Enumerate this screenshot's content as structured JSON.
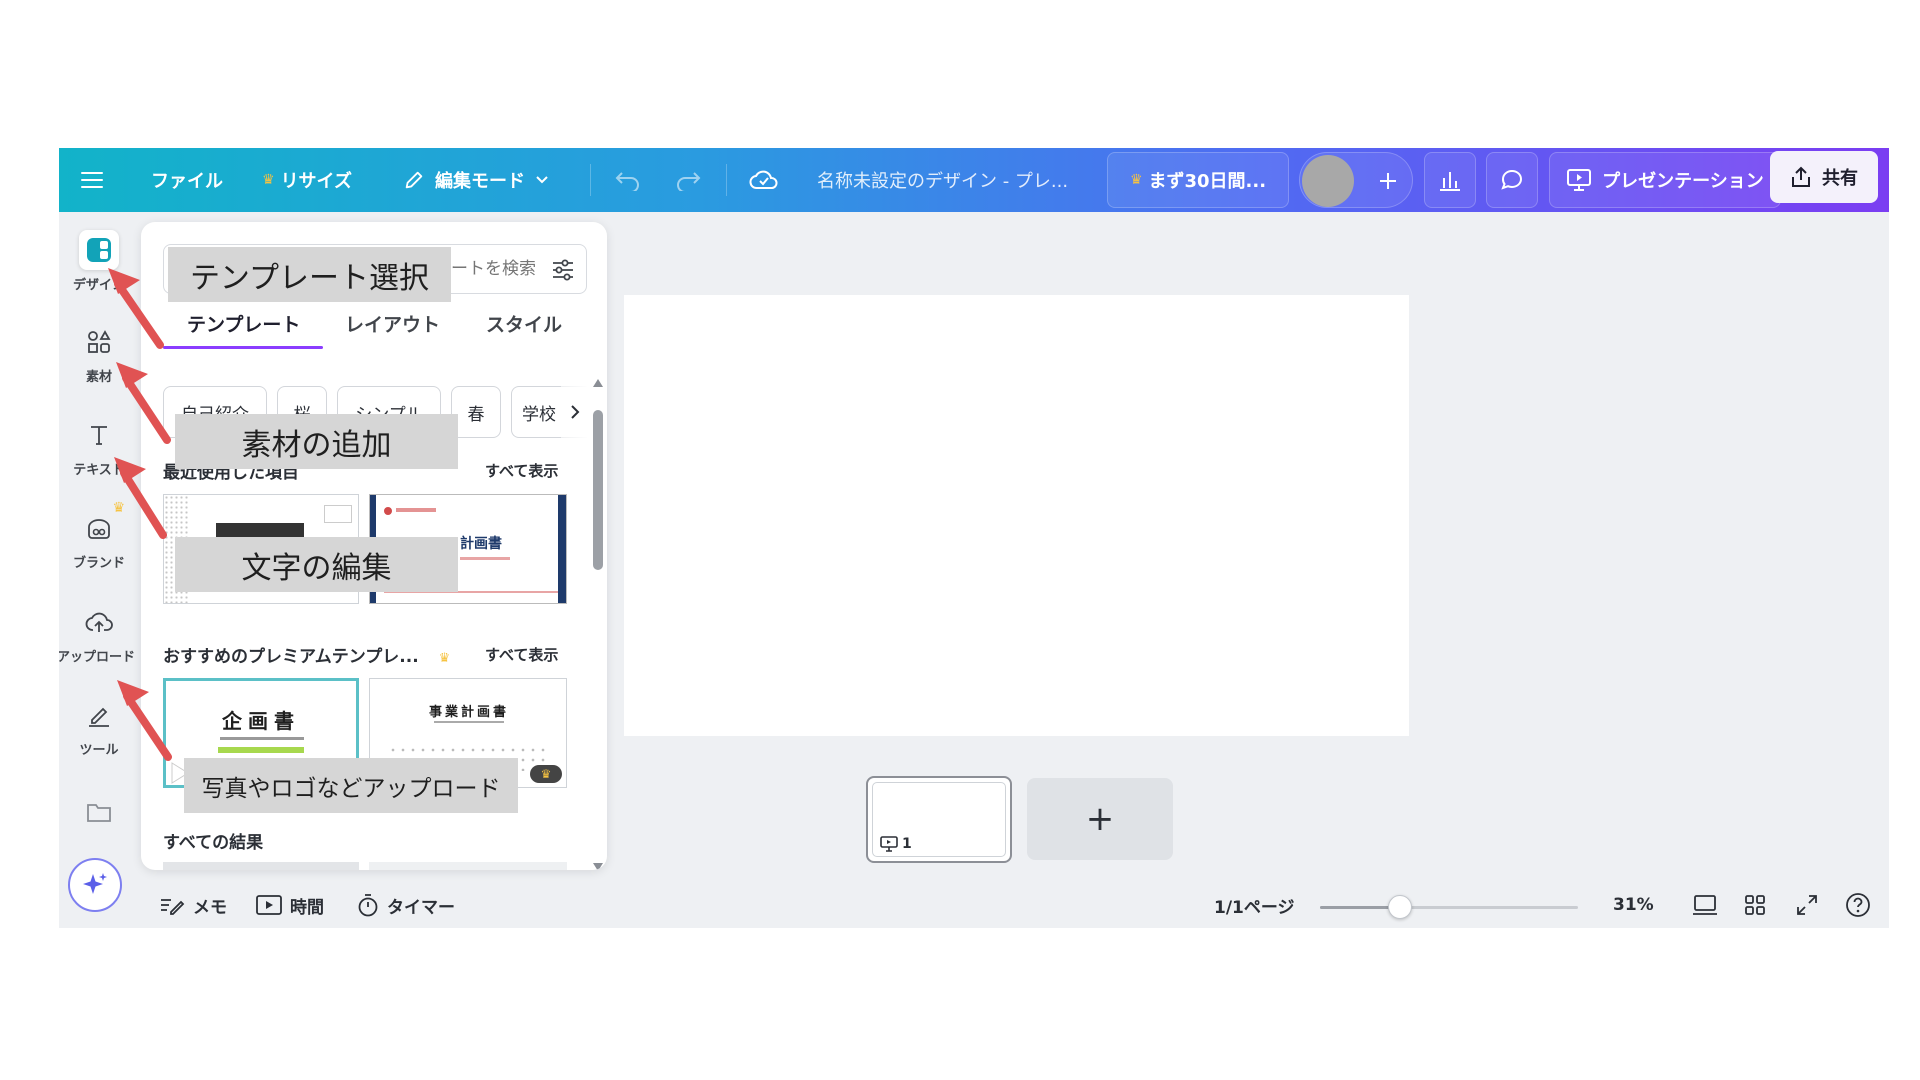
{
  "topbar": {
    "file": "ファイル",
    "resize": "リサイズ",
    "edit_mode": "編集モード",
    "doc_title": "名称未設定のデザイン - プレ...",
    "trial": "まず30日間...",
    "present": "プレゼンテーション",
    "share": "共有"
  },
  "rail": {
    "design": "デザイン",
    "elements": "素材",
    "text": "テキスト",
    "brand": "ブランド",
    "uploads": "アップロード",
    "tools": "ツール"
  },
  "panel": {
    "search_placeholder": "テンプレートを検索",
    "tabs": [
      "テンプレート",
      "レイアウト",
      "スタイル"
    ],
    "chips": [
      "自己紹介",
      "桜",
      "シンプル",
      "春",
      "学校"
    ],
    "recent_title": "最近使用した項目",
    "see_all": "すべて表示",
    "premium_title": "おすすめのプレミアムテンプレ...",
    "all_results": "すべての結果",
    "thumb_plan": "計画書",
    "thumb_kikakusho": "企画書",
    "thumb_jigyo": "事業計画書"
  },
  "canvas": {
    "page_number": "1"
  },
  "bottombar": {
    "memo": "メモ",
    "time": "時間",
    "timer": "タイマー",
    "page_indicator": "1/1ページ",
    "zoom": "31%",
    "zoom_level": 0.31
  },
  "annotations": {
    "template": "テンプレート選択",
    "elements": "素材の追加",
    "text": "文字の編集",
    "upload": "写真やロゴなどアップロード"
  },
  "colors": {
    "accent": "#8b3dff",
    "arrow": "#e05353",
    "crown": "#f6c342"
  }
}
